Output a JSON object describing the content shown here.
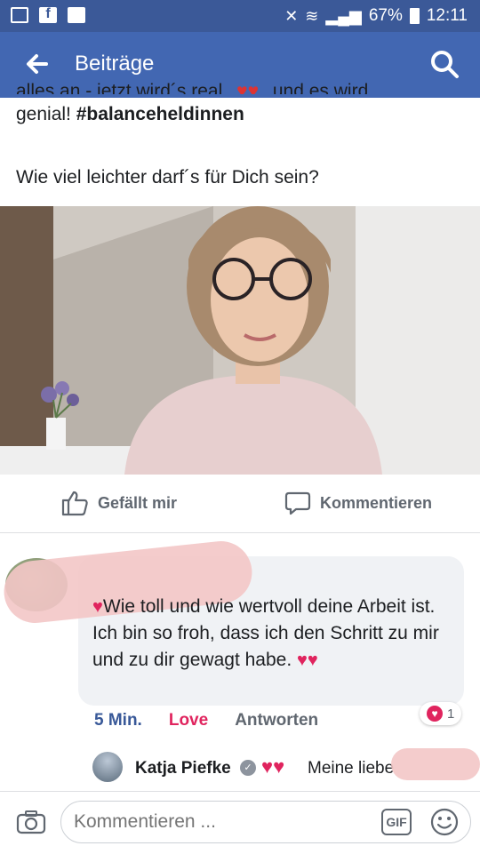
{
  "status_bar": {
    "battery_percent": "67%",
    "time": "12:11"
  },
  "header": {
    "title": "Beiträge"
  },
  "post": {
    "text_line1": "alles an - jetzt wird´s real",
    "text_line1_end": "und es wird",
    "text_line2": "genial!",
    "hashtag": "#balanceheldinnen",
    "question": "Wie viel leichter darf´s für Dich sein?"
  },
  "actions": {
    "like_label": "Gefällt mir",
    "comment_label": "Kommentieren"
  },
  "comment": {
    "text": "Wie toll und wie wertvoll deine Arbeit ist. Ich bin so froh, dass ich den Schritt zu mir und zu dir gewagt habe.",
    "time": "5 Min.",
    "love_label": "Love",
    "reply_label": "Antworten",
    "reaction_count": "1"
  },
  "reply": {
    "name": "Katja Piefke",
    "text": "Meine liebe"
  },
  "composer": {
    "placeholder": "Kommentieren ...",
    "gif_label": "GIF"
  },
  "colors": {
    "brand": "#4267b2",
    "love": "#e0245e",
    "link": "#385898"
  }
}
